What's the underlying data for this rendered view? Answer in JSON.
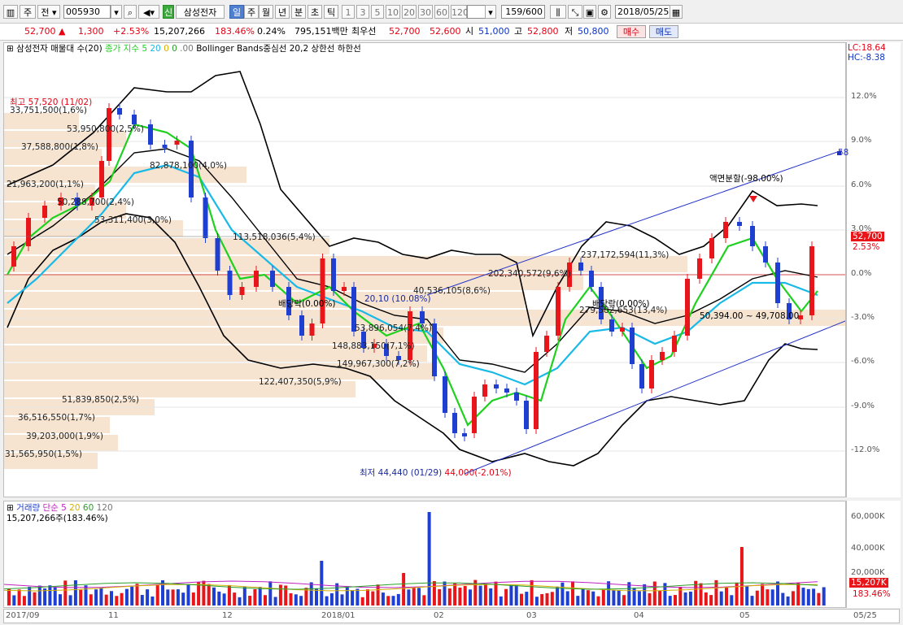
{
  "toolbar": {
    "period_unit": "주",
    "type_btn": "전",
    "code": "005930",
    "market_badge": "신",
    "stock_name": "삼성전자",
    "periods": [
      "일",
      "주",
      "월",
      "년",
      "분",
      "초",
      "틱"
    ],
    "selected_period": "일",
    "intervals": [
      "1",
      "3",
      "5",
      "10",
      "20",
      "30",
      "60",
      "120"
    ],
    "count": "159/600",
    "date": "2018/05/25"
  },
  "quote": {
    "price": "52,700",
    "change": "1,300",
    "change_pct": "+2.53%",
    "volume": "15,207,266",
    "volume_ratio": "183.46%",
    "turnover": "0.24%",
    "amount": "795,151백만",
    "best_label": "최우선",
    "ask": "52,700",
    "bid": "52,600",
    "open_label": "시",
    "open": "51,000",
    "high_label": "고",
    "high": "52,800",
    "low_label": "저",
    "low": "50,800",
    "buy_label": "매수",
    "sell_label": "매도"
  },
  "price_pane": {
    "legend_title": "삼성전자 매물대 수(20)",
    "legend_ma": "종가 지수 5",
    "legend_ma_periods": [
      "20",
      "0",
      "0"
    ],
    "legend_ma_tail": ".00",
    "legend_bb": "Bollinger Bands중심선 20,2 상한선 하한선",
    "lc": "LC:18.64",
    "hc": "HC:-8.38",
    "y_ticks": [
      "12.0%",
      "9.0%",
      "6.0%",
      "3.0%",
      "0.0%",
      "-3.0%",
      "-6.0%",
      "-9.0%",
      "-12.0%"
    ],
    "price_tag": "52,700",
    "pct_tag": "2.53%",
    "high_mark": "최고 57,520 (11/02)",
    "low_mark": "최저 44,440 (01/29)",
    "low_mark_extra": "44,000(-2.01%)",
    "split_note": "액면분할(-98.00%)",
    "dividend_1": "배당락(0.00%)",
    "dividend_2": "배당락(0.00%)",
    "trend_note": "20,10 (10.08%)",
    "range_note": "50,394.00 ~ 49,708.00",
    "trend_end": "58",
    "volume_profile": [
      {
        "label": "33,751,500(1,6%)",
        "w": 92
      },
      {
        "label": "53,950,800(2,5%)",
        "w": 150
      },
      {
        "label": "37,588,800(1,8%)",
        "w": 120
      },
      {
        "label": "82,878,100(4,0%)",
        "w": 298
      },
      {
        "label": "21,963,200(1,1%)",
        "w": 112
      },
      {
        "label": "50,288,700(2,4%)",
        "w": 150
      },
      {
        "label": "53,311,400(3,0%)",
        "w": 220
      },
      {
        "label": "113,518,036(5,4%)",
        "w": 400
      },
      {
        "label": "237,172,594(11,3%)",
        "w": 840
      },
      {
        "label": "202,340,572(9,6%)",
        "w": 712
      },
      {
        "label": "40,536,105(8,6%)",
        "w": 640
      },
      {
        "label": "279,582,653(13,4%)",
        "w": 1038
      },
      {
        "label": "53,896,054(7,4%)",
        "w": 540
      },
      {
        "label": "148,883,150(7,1%)",
        "w": 520
      },
      {
        "label": "149,967,300(7,2%)",
        "w": 530
      },
      {
        "label": "122,407,350(5,9%)",
        "w": 432
      },
      {
        "label": "51,839,850(2,5%)",
        "w": 185
      },
      {
        "label": "36,516,550(1,7%)",
        "w": 130
      },
      {
        "label": "39,203,000(1,9%)",
        "w": 140
      },
      {
        "label": "31,565,950(1,5%)",
        "w": 115
      }
    ]
  },
  "volume_pane": {
    "legend_name": "거래량",
    "legend_ma": "단순 5",
    "legend_periods": [
      "20",
      "60",
      "120"
    ],
    "current": "15,207,266주(183.46%)",
    "y_ticks": [
      "60,000K",
      "40,000K",
      "20,000K"
    ],
    "value_tag": "15,207K",
    "pct_tag": "183.46%"
  },
  "x_axis": [
    "2017/09",
    "11",
    "12",
    "2018/01",
    "02",
    "03",
    "04",
    "05",
    "05/25"
  ],
  "colors": {
    "up": "#e8151b",
    "down": "#1f3fd0",
    "ma5": "#1fd11f",
    "ma20": "#19b9e8",
    "bb": "#000000",
    "profile": "#f6e4d0",
    "trend": "#2030c8"
  }
}
